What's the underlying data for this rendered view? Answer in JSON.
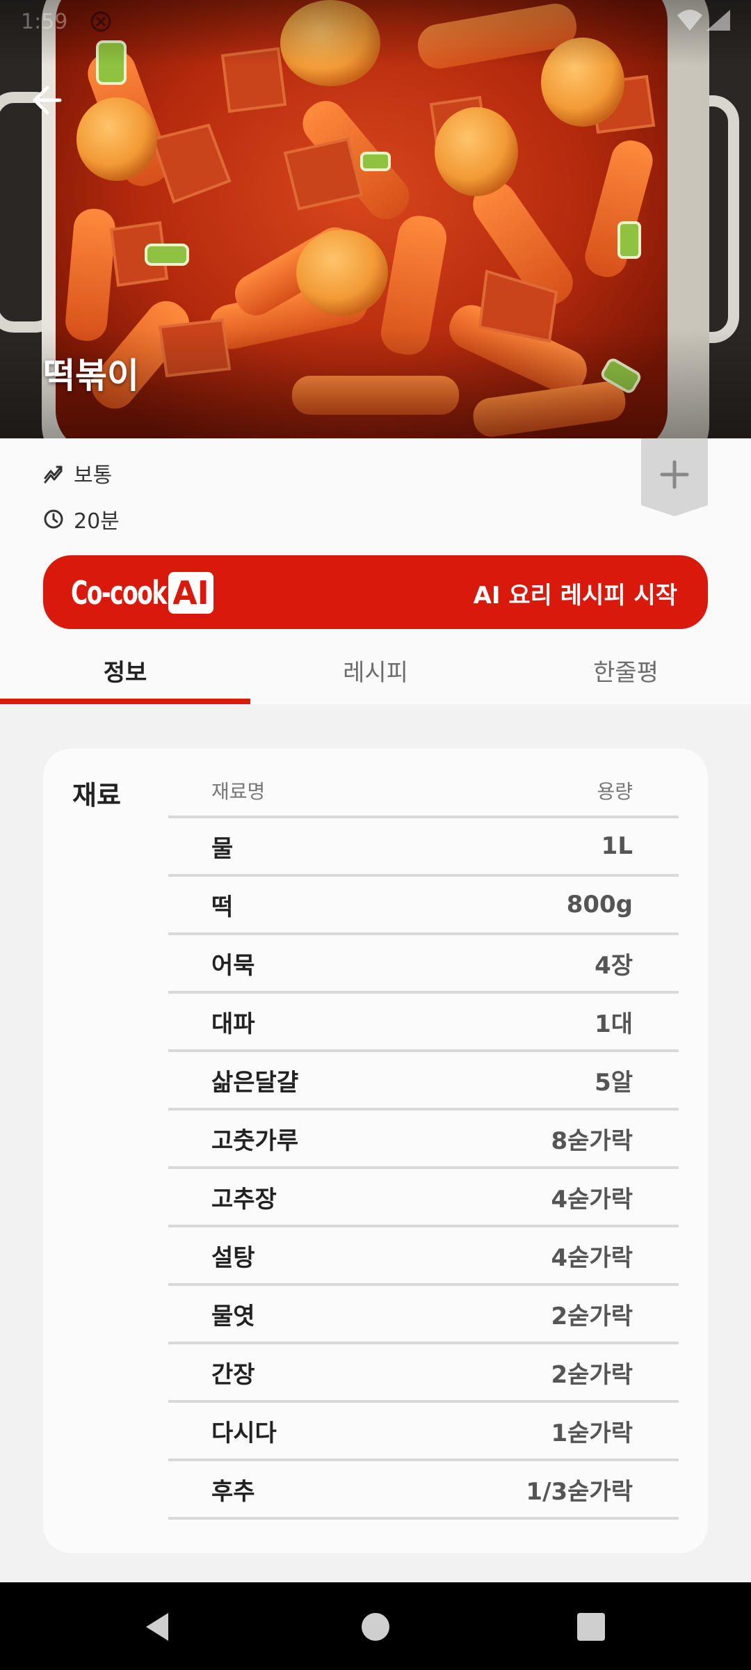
{
  "status_bar": {
    "time": "1:59"
  },
  "hero": {
    "title": "떡볶이"
  },
  "info": {
    "difficulty": "보통",
    "time": "20분",
    "bookmark_icon": "plus-icon"
  },
  "banner": {
    "logo_text": "Co-cook!",
    "logo_badge": "AI",
    "cta": "AI 요리 레시피 시작",
    "color": "#d8190c"
  },
  "tabs": [
    {
      "label": "정보",
      "active": true
    },
    {
      "label": "레시피",
      "active": false
    },
    {
      "label": "한줄평",
      "active": false
    }
  ],
  "ingredients": {
    "section_label": "재료",
    "header": {
      "name": "재료명",
      "amount": "용량"
    },
    "rows": [
      {
        "name": "물",
        "amount": "1L"
      },
      {
        "name": "떡",
        "amount": "800g"
      },
      {
        "name": "어묵",
        "amount": "4장"
      },
      {
        "name": "대파",
        "amount": "1대"
      },
      {
        "name": "삶은달걀",
        "amount": "5알"
      },
      {
        "name": "고춧가루",
        "amount": "8숟가락"
      },
      {
        "name": "고추장",
        "amount": "4숟가락"
      },
      {
        "name": "설탕",
        "amount": "4숟가락"
      },
      {
        "name": "물엿",
        "amount": "2숟가락"
      },
      {
        "name": "간장",
        "amount": "2숟가락"
      },
      {
        "name": "다시다",
        "amount": "1숟가락"
      },
      {
        "name": "후추",
        "amount": "1/3숟가락"
      }
    ]
  }
}
